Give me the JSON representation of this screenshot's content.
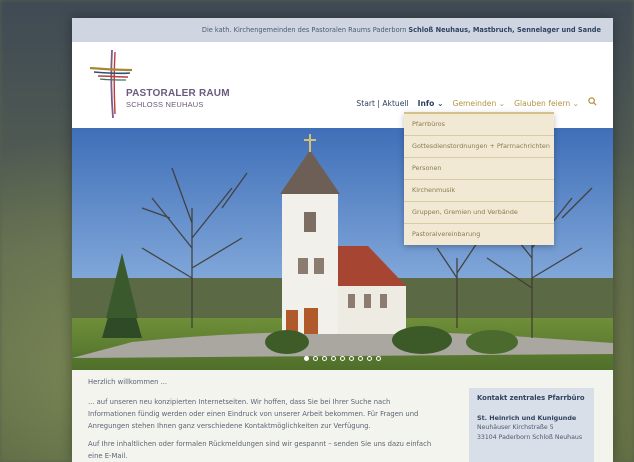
{
  "topbar": {
    "text": "Die kath. Kirchengemeinden des Pastoralen Raums Paderborn",
    "bold": "Schloß Neuhaus, Mastbruch, Sennelager und Sande"
  },
  "logo": {
    "line1": "PASTORALER RAUM",
    "line2": "SCHLOSS NEUHAUS"
  },
  "nav": {
    "start": "Start | Aktuell",
    "info": "Info",
    "gemeinden": "Gemeinden",
    "glauben": "Glauben feiern",
    "chevron": "⌄",
    "search_icon": "search-icon"
  },
  "dropdown": {
    "items": [
      "Pfarrbüros",
      "Gottesdienstordnungen + Pfarrnachrichten",
      "Personen",
      "Kirchenmusik",
      "Gruppen, Gremien und Verbände",
      "Pastoralvereinbarung"
    ]
  },
  "slider": {
    "dot_count": 9,
    "active_index": 0
  },
  "content": {
    "welcome": "Herzlich willkommen ...",
    "para1": "... auf unseren neu konzipierten Internetseiten. Wir hoffen, dass Sie bei Ihrer Suche nach Informationen fündig werden oder einen Eindruck von unserer Arbeit bekommen. Für Fragen und Anregungen stehen Ihnen ganz verschiedene Kontaktmöglichkeiten zur Verfügung.",
    "para2": "Auf Ihre inhaltlichen oder formalen Rückmeldungen sind wir gespannt – senden Sie uns dazu einfach eine E-Mail."
  },
  "sidebar": {
    "title": "Kontakt zentrales Pfarrbüro",
    "name": "St. Heinrich und Kunigunde",
    "street": "Neuhäuser Kirchstraße 5",
    "city": "33104 Paderborn Schloß Neuhaus"
  },
  "colors": {
    "topbar_bg": "#cfd6e2",
    "navy": "#2f4260",
    "gold": "#b39445",
    "dropdown_bg": "#f1e9d3"
  }
}
